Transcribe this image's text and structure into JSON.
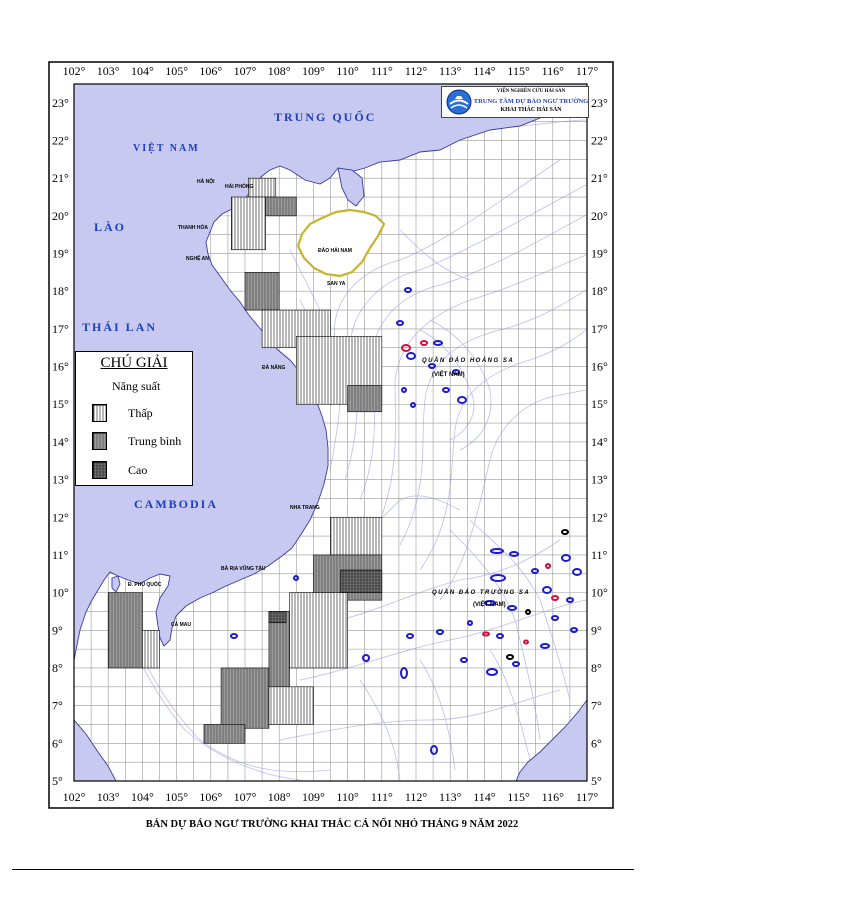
{
  "map": {
    "lon_labels": [
      "102°",
      "103°",
      "104°",
      "105°",
      "106°",
      "107°",
      "108°",
      "109°",
      "110°",
      "111°",
      "112°",
      "113°",
      "114°",
      "115°",
      "116°",
      "117°"
    ],
    "lat_labels": [
      "23°",
      "22°",
      "21°",
      "20°",
      "19°",
      "18°",
      "17°",
      "16°",
      "15°",
      "14°",
      "13°",
      "12°",
      "11°",
      "10°",
      "9°",
      "8°",
      "7°",
      "6°",
      "5°"
    ],
    "colors": {
      "land": "#c8c9f0",
      "sea": "#ffffff",
      "grid": "#999999",
      "contour": "#bcbef0",
      "reef_blue": "#1a1ad0",
      "reef_red": "#d0103a",
      "frame": "#000000",
      "label_blue": "#1c3fbf"
    }
  },
  "countries": {
    "china": "TRUNG QUỐC",
    "vietnam": "VIỆT NAM",
    "laos": "LÀO",
    "thailand": "THÁI LAN",
    "cambodia": "CAMBODIA"
  },
  "places": {
    "ha_noi": "HÀ NỘI",
    "hai_phong": "HẢI PHÒNG",
    "thanh_hoa": "THANH HÓA",
    "nghe_an": "NGHỆ AN",
    "da_nang": "ĐÀ NẴNG",
    "nha_trang": "NHA TRANG",
    "ba_ria": "BÀ RỊA VŨNG TÀU",
    "ca_mau": "CÀ MAU",
    "phu_quoc": "Đ. PHÚ QUỐC",
    "hai_nam": "ĐẢO HẢI NAM",
    "san_ya": "SAN YA"
  },
  "archipelagos": {
    "hoang_sa": "QUẦN ĐẢO HOÀNG SA",
    "hoang_sa_vn": "(VIỆT NAM)",
    "truong_sa": "QUẦN ĐẢO TRƯỜNG SA",
    "truong_sa_vn": "(VIỆT NAM)"
  },
  "legend": {
    "title": "CHÚ GIẢI",
    "subtitle": "Năng suất",
    "items": [
      {
        "label": "Thấp",
        "pattern": "vert"
      },
      {
        "label": "Trung bình",
        "pattern": "gray"
      },
      {
        "label": "Cao",
        "pattern": "dark"
      }
    ]
  },
  "institute": {
    "line1": "VIỆN NGHIÊN CỨU HẢI SẢN",
    "line2": "TRUNG TÂM DỰ BÁO NGƯ TRƯỜNG",
    "line3": "KHAI THÁC HẢI SẢN"
  },
  "caption": "BẢN DỰ BÁO NGƯ TRƯỜNG KHAI THÁC CÁ NỔI NHỎ THÁNG 9 NĂM 2022",
  "forecast_zones": [
    {
      "lon": [
        107.1,
        107.9
      ],
      "lat": [
        20.5,
        21.0
      ],
      "level": "thap"
    },
    {
      "lon": [
        106.6,
        107.6
      ],
      "lat": [
        19.1,
        20.5
      ],
      "level": "thap"
    },
    {
      "lon": [
        107.6,
        108.5
      ],
      "lat": [
        20.0,
        20.5
      ],
      "level": "trung_binh"
    },
    {
      "lon": [
        107.0,
        108.0
      ],
      "lat": [
        17.5,
        18.5
      ],
      "level": "trung_binh"
    },
    {
      "lon": [
        107.5,
        109.5
      ],
      "lat": [
        16.5,
        17.5
      ],
      "level": "thap"
    },
    {
      "lon": [
        108.5,
        111.0
      ],
      "lat": [
        15.0,
        16.8
      ],
      "level": "thap"
    },
    {
      "lon": [
        110.0,
        111.0
      ],
      "lat": [
        14.8,
        15.5
      ],
      "level": "trung_binh"
    },
    {
      "lon": [
        109.5,
        111.0
      ],
      "lat": [
        11.0,
        12.0
      ],
      "level": "thap"
    },
    {
      "lon": [
        109.0,
        111.0
      ],
      "lat": [
        9.8,
        11.0
      ],
      "level": "trung_binh"
    },
    {
      "lon": [
        109.8,
        111.0
      ],
      "lat": [
        10.0,
        10.6
      ],
      "level": "cao"
    },
    {
      "lon": [
        108.3,
        110.0
      ],
      "lat": [
        8.0,
        10.0
      ],
      "level": "thap"
    },
    {
      "lon": [
        107.7,
        108.3
      ],
      "lat": [
        7.0,
        9.5
      ],
      "level": "trung_binh"
    },
    {
      "lon": [
        107.7,
        108.2
      ],
      "lat": [
        9.2,
        9.5
      ],
      "level": "cao"
    },
    {
      "lon": [
        106.3,
        107.7
      ],
      "lat": [
        6.4,
        8.0
      ],
      "level": "trung_binh"
    },
    {
      "lon": [
        107.7,
        109.0
      ],
      "lat": [
        6.5,
        7.5
      ],
      "level": "thap"
    },
    {
      "lon": [
        105.8,
        107.0
      ],
      "lat": [
        6.0,
        6.5
      ],
      "level": "trung_binh"
    },
    {
      "lon": [
        103.0,
        104.0
      ],
      "lat": [
        8.0,
        10.0
      ],
      "level": "trung_binh"
    },
    {
      "lon": [
        104.0,
        104.5
      ],
      "lat": [
        8.0,
        9.0
      ],
      "level": "thap"
    }
  ]
}
